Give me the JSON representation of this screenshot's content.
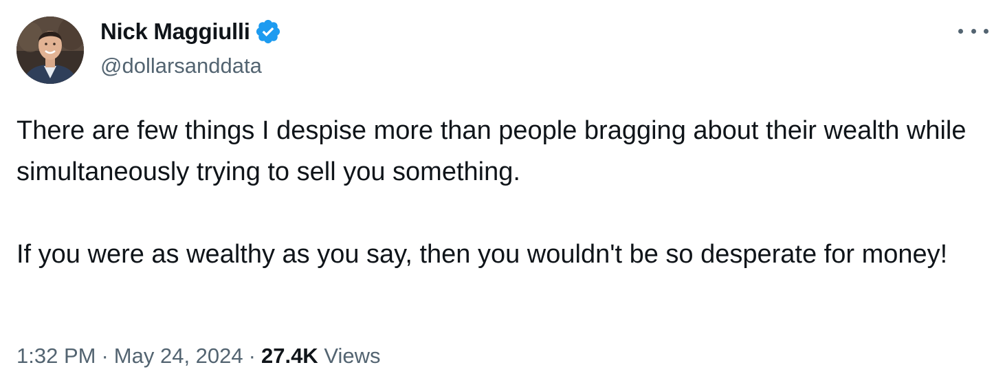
{
  "author": {
    "display_name": "Nick Maggiulli",
    "handle": "@dollarsanddata",
    "verified_icon": "verified-badge-icon",
    "avatar": "profile-photo"
  },
  "tweet": {
    "paragraphs": [
      "There are few things I despise more than people bragging about their wealth while simultaneously trying to sell you something.",
      "If you were as wealthy as you say, then you wouldn't be so desperate for money!"
    ],
    "time": "1:32 PM",
    "separator": "·",
    "date": "May 24, 2024",
    "views_count": "27.4K",
    "views_label": "Views"
  },
  "menu": {
    "icon": "more-options-icon"
  },
  "colors": {
    "text_primary": "#0f1419",
    "text_secondary": "#536471",
    "verified_blue": "#1d9bf0",
    "background": "#ffffff"
  }
}
